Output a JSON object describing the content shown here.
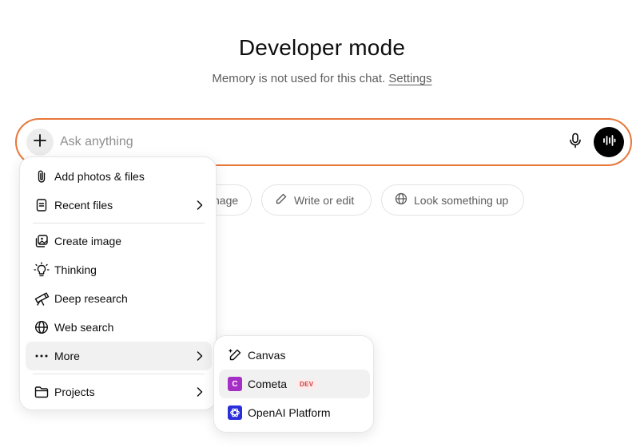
{
  "header": {
    "title": "Developer mode",
    "subtitle": "Memory is not used for this chat.",
    "settings_link": "Settings"
  },
  "composer": {
    "placeholder": "Ask anything"
  },
  "chips": [
    {
      "label": "nage",
      "icon": "image-icon"
    },
    {
      "label": "Write or edit",
      "icon": "pencil-icon"
    },
    {
      "label": "Look something up",
      "icon": "globe-icon"
    }
  ],
  "menu": {
    "items": [
      {
        "label": "Add photos & files",
        "icon": "paperclip-icon"
      },
      {
        "label": "Recent files",
        "icon": "file-icon",
        "has_submenu": true
      },
      {
        "label": "Create image",
        "icon": "image-stack-icon"
      },
      {
        "label": "Thinking",
        "icon": "lightbulb-icon"
      },
      {
        "label": "Deep research",
        "icon": "telescope-icon"
      },
      {
        "label": "Web search",
        "icon": "globe-icon"
      },
      {
        "label": "More",
        "icon": "ellipsis-icon",
        "has_submenu": true,
        "active": true
      },
      {
        "label": "Projects",
        "icon": "folder-icon",
        "has_submenu": true
      }
    ]
  },
  "submenu": {
    "items": [
      {
        "label": "Canvas",
        "icon": "canvas-pen-icon"
      },
      {
        "label": "Cometa",
        "icon": "cometa-app-icon",
        "icon_letter": "C",
        "badge": "DEV",
        "active": true
      },
      {
        "label": "OpenAI Platform",
        "icon": "openai-logo-icon"
      }
    ]
  },
  "colors": {
    "composer_border": "#e8773a",
    "cometa_icon": "#a52fc4",
    "openai_icon": "#2b2fd9",
    "dev_badge": "#d23b3b"
  }
}
